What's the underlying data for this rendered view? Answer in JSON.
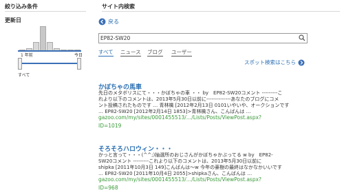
{
  "sidebar": {
    "title": "絞り込み条件",
    "date_label": "更新日",
    "left_caption": "1 年前",
    "right_caption": "今日",
    "all_label": "すべて",
    "histogram": [
      0.05,
      0.12,
      0.35,
      1.0,
      0.35,
      0.12,
      0.05,
      0.04,
      0.04
    ]
  },
  "main": {
    "title": "サイト内検索",
    "back_label": "戻る",
    "search_value": "EP82-SW20",
    "tabs": [
      "すべて",
      "ニュース",
      "ブログ",
      "ユーザー"
    ],
    "spot_link": "スポット検索はこちら"
  },
  "results": [
    {
      "title": "かぼちゃの馬車",
      "lines": [
        "先日のメタボリスにて・・・かぼちゃの車 ・・ by　EP82-SW20コメント ---------こ",
        "れより以下のコメントは、2013年5月30日以前に--------------あなたのブログにコメ",
        "ント投稿されたものです … 青林檎 [2012年2月13日 0101いやいや、オークションです",
        "… EP82-SW20 [2012年2月14日 1853]>青林檎さん、こんばんは …"
      ],
      "url": "gazoo.com/my/sites/0001455513/…/Lists/Posts/ViewPost.aspx?",
      "id": "ID=1019"
    },
    {
      "title": "そろそろハロウィン・・・",
      "lines": [
        "かっと言って・・・(^^;)抽選所のおじさんがかぼちゃかぶってる w by　EP82-",
        "SW20コメント ---------これより以下のコメントは、2013年5月30日以前に",
        "shipka [2011年10月3日 149]こんばんは～w 今年の豪樹の最終はなかなかいいです",
        "… EP82-SW20 [2011年10月4日 2055]>shipkaさん、こんばんは …"
      ],
      "url": "gazoo.com/my/sites/0001455513/…/Lists/Posts/ViewPost.aspx?",
      "id": "ID=968"
    }
  ]
}
